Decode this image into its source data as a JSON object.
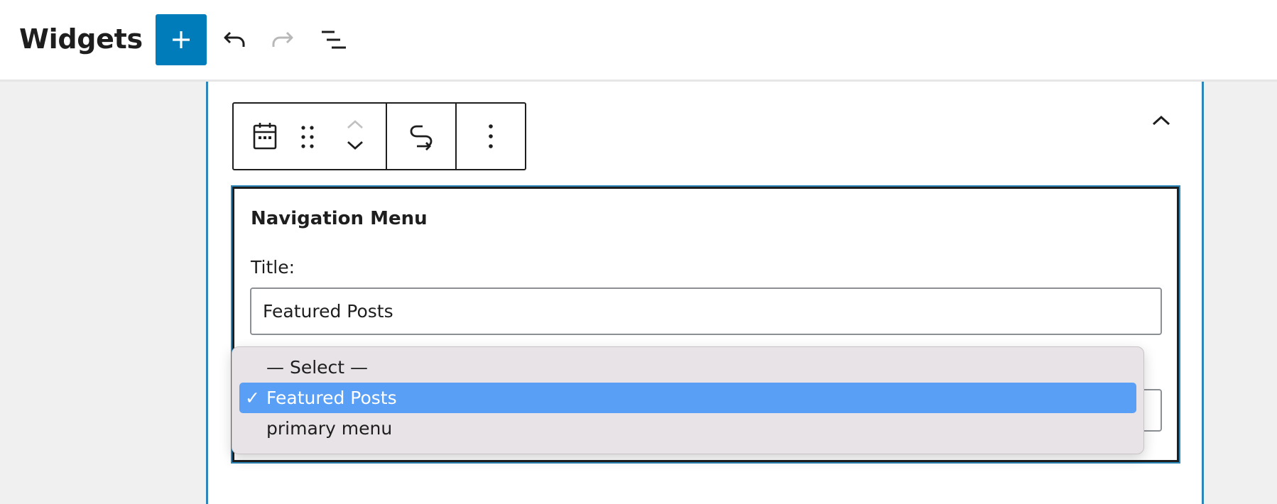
{
  "header": {
    "title": "Widgets",
    "add_button_icon": "plus-icon",
    "undo_icon": "undo-icon",
    "redo_icon": "redo-icon",
    "list_view_icon": "list-view-icon"
  },
  "colors": {
    "primary": "#007cba",
    "focus_border": "#2c86b8",
    "selected_option": "#5a9ff6",
    "dropdown_bg": "#e8e3e6"
  },
  "block_toolbar": {
    "block_icon": "calendar-icon",
    "drag_icon": "drag-handle-icon",
    "move_up_icon": "chevron-up-icon",
    "move_down_icon": "chevron-down-icon",
    "transform_icon": "transform-icon",
    "options_icon": "more-vertical-icon"
  },
  "widget": {
    "name": "Navigation Menu",
    "title_label": "Title:",
    "title_value": "Featured Posts"
  },
  "dropdown": {
    "options": [
      {
        "label": "— Select —",
        "selected": false
      },
      {
        "label": "Featured Posts",
        "selected": true
      },
      {
        "label": "primary menu",
        "selected": false
      }
    ],
    "check_mark": "✓"
  },
  "area": {
    "collapse_icon": "chevron-up-icon"
  }
}
